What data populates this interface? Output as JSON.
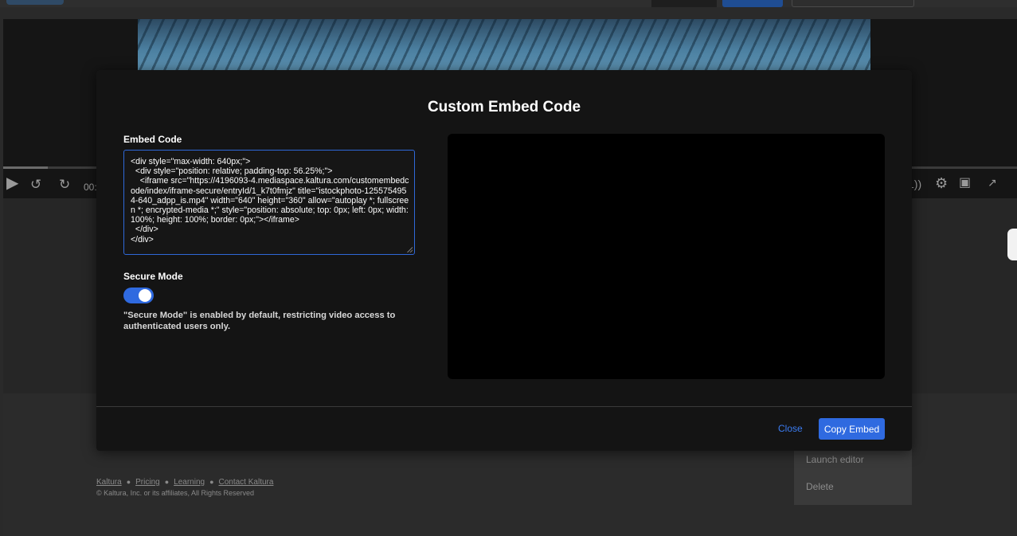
{
  "background": {
    "player": {
      "time_label": "00:",
      "controls": [
        "play-icon",
        "rewind-10-icon",
        "forward-10-icon",
        "volume-icon",
        "settings-icon",
        "picture-in-picture-icon",
        "fullscreen-icon"
      ]
    },
    "actions_menu": {
      "items": [
        "Launch editor",
        "Delete"
      ]
    },
    "footer": {
      "links": [
        "Kaltura",
        "Pricing",
        "Learning",
        "Contact Kaltura"
      ],
      "copyright": "© Kaltura, Inc. or its affiliates, All Rights Reserved"
    }
  },
  "modal": {
    "title": "Custom Embed Code",
    "embed_label": "Embed Code",
    "embed_code": "<div style=\"max-width: 640px;\">\n  <div style=\"position: relative; padding-top: 56.25%;\">\n    <iframe src=\"https://4196093-4.mediaspace.kaltura.com/customembedcode/index/iframe-secure/entryId/1_k7t0fmjz\" title=\"istockphoto-1255754954-640_adpp_is.mp4\" width=\"640\" height=\"360\" allow=\"autoplay *; fullscreen *; encrypted-media *;\" style=\"position: absolute; top: 0px; left: 0px; width: 100%; height: 100%; border: 0px;\"></iframe>\n  </div>\n</div>",
    "secure_mode": {
      "label": "Secure Mode",
      "enabled": true,
      "description": "\"Secure Mode\" is enabled by default, restricting video access to authenticated users only."
    },
    "buttons": {
      "close": "Close",
      "copy": "Copy Embed"
    }
  },
  "colors": {
    "accent": "#2f6ae0",
    "link": "#3b7cf2",
    "modal_bg": "#141414"
  }
}
